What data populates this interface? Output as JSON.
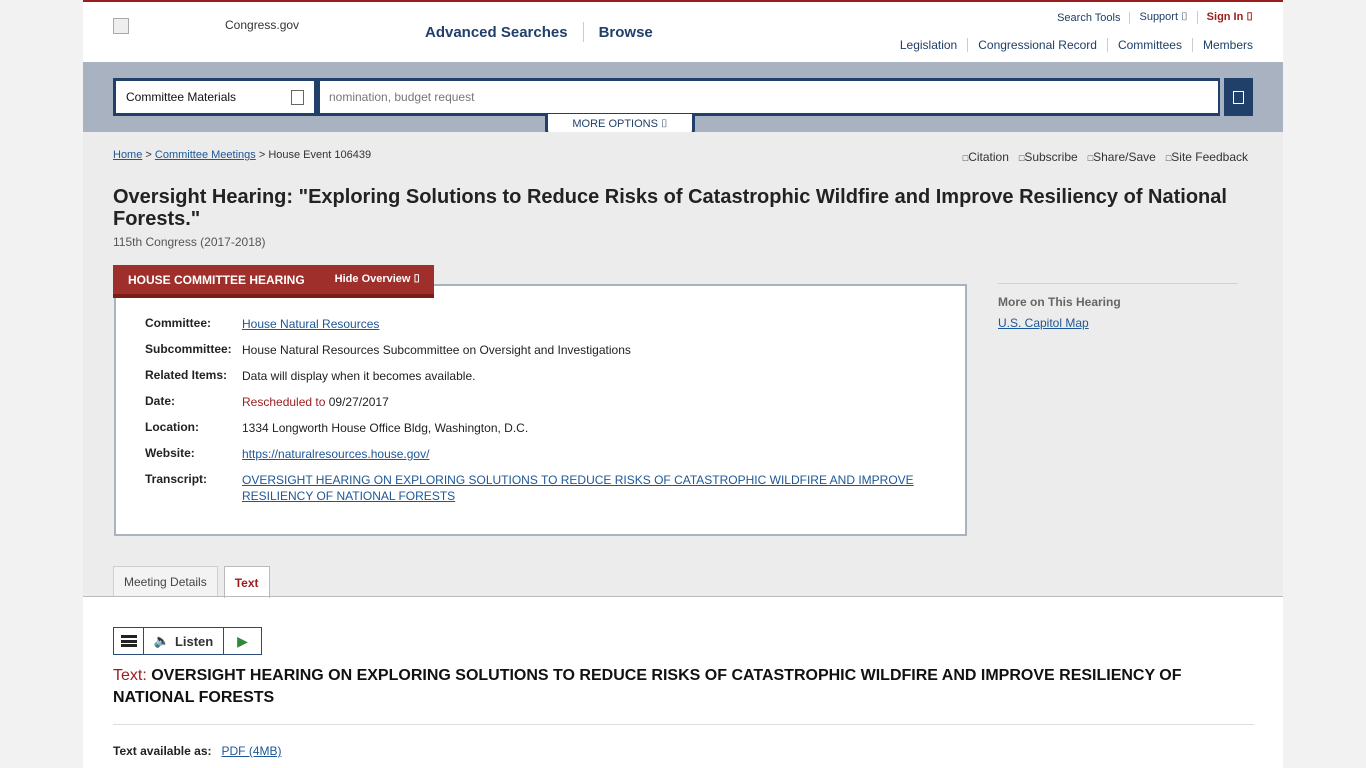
{
  "header": {
    "logo_text": "Congress.gov",
    "main_nav": [
      "Advanced Searches",
      "Browse"
    ],
    "utility": {
      "search_tools": "Search Tools",
      "support": "Support ⌷",
      "sign_in": "Sign In ⌷"
    },
    "sec_nav": [
      "Legislation",
      "Congressional Record",
      "Committees",
      "Members"
    ]
  },
  "search": {
    "scope": "Committee Materials",
    "placeholder": "nomination, budget request",
    "more_options": "MORE OPTIONS ⌷"
  },
  "breadcrumb": {
    "home": "Home",
    "sep1": " > ",
    "meetings": "Committee Meetings",
    "sep2": " > ",
    "current": "House Event 106439"
  },
  "tools": [
    "Citation",
    "Subscribe",
    "Share/Save",
    "Site Feedback"
  ],
  "page": {
    "title": "Oversight Hearing: \"Exploring Solutions to Reduce Risks of Catastrophic Wildfire and Improve Resiliency of National Forests.\"",
    "congress": "115th Congress (2017-2018)"
  },
  "overview": {
    "tab_label": "HOUSE COMMITTEE HEARING",
    "hide_label": "Hide Overview ⌷",
    "committee_label": "Committee:",
    "committee_value": "House Natural Resources",
    "subcommittee_label": "Subcommittee:",
    "subcommittee_value": "House Natural Resources Subcommittee on Oversight and Investigations",
    "related_label": "Related Items:",
    "related_value": "Data will display when it becomes available.",
    "date_label": "Date:",
    "date_prefix": "Rescheduled to",
    "date_value": " 09/27/2017",
    "location_label": "Location:",
    "location_value": "1334 Longworth House Office Bldg, Washington, D.C.",
    "website_label": "Website:",
    "website_value": "https://naturalresources.house.gov/",
    "transcript_label": "Transcript:",
    "transcript_value": "OVERSIGHT HEARING ON EXPLORING SOLUTIONS TO REDUCE RISKS OF CATASTROPHIC WILDFIRE AND IMPROVE RESILIENCY OF NATIONAL FORESTS"
  },
  "more_on": {
    "heading": "More on This Hearing",
    "link": "U.S. Capitol Map"
  },
  "tabs": {
    "details": "Meeting Details",
    "text": "Text"
  },
  "listen": {
    "label": "Listen",
    "play": "▶"
  },
  "text_section": {
    "prefix": "Text: ",
    "title": "OVERSIGHT HEARING ON EXPLORING SOLUTIONS TO REDUCE RISKS OF CATASTROPHIC WILDFIRE AND IMPROVE RESILIENCY OF NATIONAL FORESTS",
    "available_label": "Text available as:",
    "pdf_link": "PDF (4MB)"
  }
}
